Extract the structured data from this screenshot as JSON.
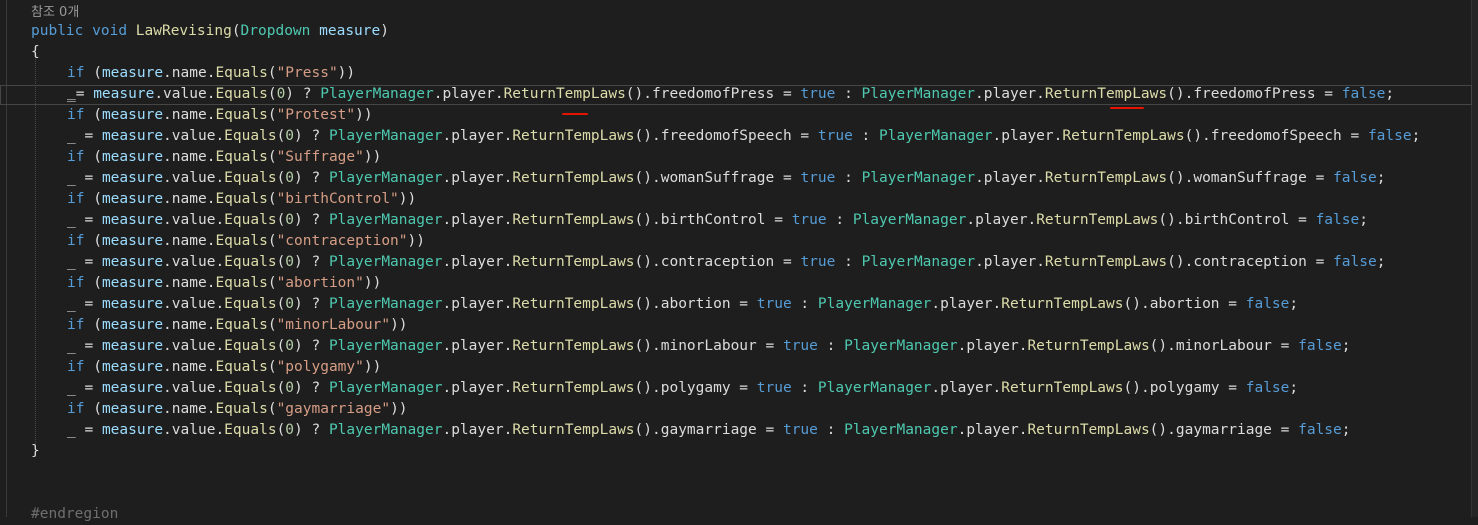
{
  "editor": {
    "codelens": "참조 0개",
    "signature": {
      "kw_public": "public",
      "kw_void": "void",
      "method": "LawRevising",
      "open": "(",
      "param_type": "Dropdown",
      "param_name": "measure",
      "close": ")"
    },
    "open_brace": "{",
    "close_brace": "}",
    "region_end": "#endregion",
    "common": {
      "kw_if": "if",
      "measure": "measure",
      "name": "name",
      "value": "value",
      "equals": "Equals",
      "discard": "_",
      "zero": "0",
      "player_manager": "PlayerManager",
      "player": "player",
      "return_temp_laws": "ReturnTempLaws",
      "kw_true": "true",
      "kw_false": "false"
    },
    "laws": [
      {
        "string": "\"Press\"",
        "field": "freedomofPress"
      },
      {
        "string": "\"Protest\"",
        "field": "freedomofSpeech"
      },
      {
        "string": "\"Suffrage\"",
        "field": "womanSuffrage"
      },
      {
        "string": "\"birthControl\"",
        "field": "birthControl"
      },
      {
        "string": "\"contraception\"",
        "field": "contraception"
      },
      {
        "string": "\"abortion\"",
        "field": "abortion"
      },
      {
        "string": "\"minorLabour\"",
        "field": "minorLabour"
      },
      {
        "string": "\"polygamy\"",
        "field": "polygamy"
      },
      {
        "string": "\"gaymarriage\"",
        "field": "gaymarriage"
      }
    ]
  },
  "colors": {
    "background": "#1e1e1e",
    "keyword": "#569cd6",
    "type": "#4ec9b0",
    "method": "#dcdcaa",
    "variable": "#9cdcfe",
    "string": "#d69d85",
    "number": "#b5cea8",
    "annotation_red": "#e51400"
  }
}
